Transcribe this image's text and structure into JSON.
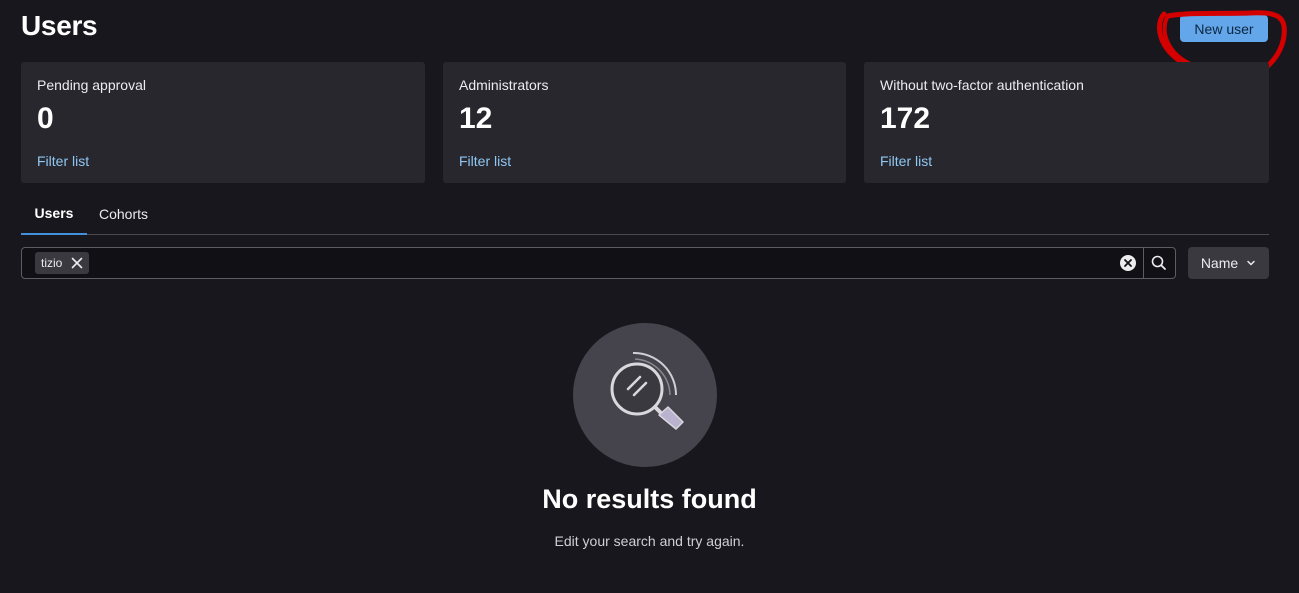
{
  "header": {
    "title": "Users",
    "new_user_label": "New user"
  },
  "stats": [
    {
      "label": "Pending approval",
      "value": "0",
      "link": "Filter list"
    },
    {
      "label": "Administrators",
      "value": "12",
      "link": "Filter list"
    },
    {
      "label": "Without two-factor authentication",
      "value": "172",
      "link": "Filter list"
    }
  ],
  "tabs": [
    {
      "label": "Users",
      "active": true
    },
    {
      "label": "Cohorts",
      "active": false
    }
  ],
  "search": {
    "token": "tizio"
  },
  "sort": {
    "selected": "Name"
  },
  "empty_state": {
    "title": "No results found",
    "description": "Edit your search and try again."
  },
  "colors": {
    "background": "#18171d",
    "card": "#28272d",
    "primary_button": "#63a6e9",
    "link": "#8fc7f5",
    "annotation": "#d40000"
  },
  "icons": {
    "token_close": "close-icon",
    "clear": "clear-circle-icon",
    "search": "search-icon",
    "sort_chevron": "chevron-down-icon",
    "empty": "magnifier-illustration"
  }
}
